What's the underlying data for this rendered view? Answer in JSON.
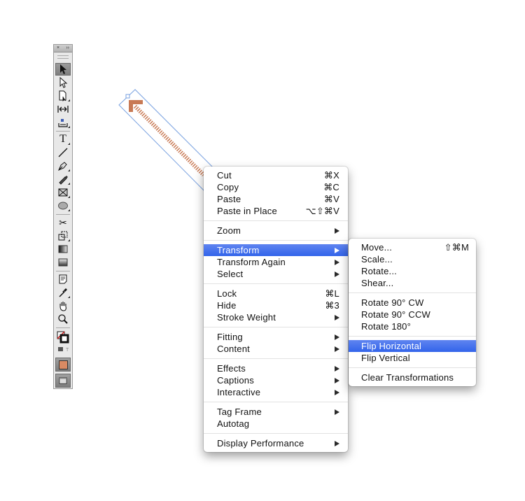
{
  "toolbox": {
    "close_glyph": "×",
    "collapse_glyph": "››",
    "tools": [
      {
        "name": "selection-tool",
        "active": true
      },
      {
        "name": "direct-selection-tool",
        "active": false
      },
      {
        "name": "page-tool",
        "active": false
      },
      {
        "name": "gap-tool",
        "active": false
      },
      {
        "name": "content-collector-tool",
        "active": false
      },
      {
        "name": "type-tool",
        "active": false,
        "glyph": "T"
      },
      {
        "name": "line-tool",
        "active": false
      },
      {
        "name": "pen-tool",
        "active": false
      },
      {
        "name": "pencil-tool",
        "active": false
      },
      {
        "name": "rectangle-frame-tool",
        "active": false
      },
      {
        "name": "ellipse-tool",
        "active": false
      },
      {
        "name": "scissors-tool",
        "active": false,
        "glyph": "✂"
      },
      {
        "name": "free-transform-tool",
        "active": false
      },
      {
        "name": "gradient-swatch-tool",
        "active": false
      },
      {
        "name": "gradient-feather-tool",
        "active": false
      },
      {
        "name": "note-tool",
        "active": false
      },
      {
        "name": "eyedropper-tool",
        "active": false
      },
      {
        "name": "hand-tool",
        "active": false
      },
      {
        "name": "zoom-tool",
        "active": false
      }
    ],
    "fill_color": "#ffffff",
    "stroke_color": "#c87a55",
    "formatting_swatch_color": "#d98a63"
  },
  "canvas": {
    "arrow_color": "#c87a55",
    "selection_color": "#7aa2e0"
  },
  "context_menu": {
    "groups": [
      [
        {
          "label": "Cut",
          "shortcut": "⌘X"
        },
        {
          "label": "Copy",
          "shortcut": "⌘C"
        },
        {
          "label": "Paste",
          "shortcut": "⌘V"
        },
        {
          "label": "Paste in Place",
          "shortcut": "⌥⇧⌘V"
        }
      ],
      [
        {
          "label": "Zoom",
          "submenu": true
        }
      ],
      [
        {
          "label": "Transform",
          "submenu": true,
          "highlighted": true
        },
        {
          "label": "Transform Again",
          "submenu": true
        },
        {
          "label": "Select",
          "submenu": true
        }
      ],
      [
        {
          "label": "Lock",
          "shortcut": "⌘L"
        },
        {
          "label": "Hide",
          "shortcut": "⌘3"
        },
        {
          "label": "Stroke Weight",
          "submenu": true
        }
      ],
      [
        {
          "label": "Fitting",
          "submenu": true
        },
        {
          "label": "Content",
          "submenu": true
        }
      ],
      [
        {
          "label": "Effects",
          "submenu": true
        },
        {
          "label": "Captions",
          "submenu": true
        },
        {
          "label": "Interactive",
          "submenu": true
        }
      ],
      [
        {
          "label": "Tag Frame",
          "submenu": true
        },
        {
          "label": "Autotag"
        }
      ],
      [
        {
          "label": "Display Performance",
          "submenu": true
        }
      ]
    ]
  },
  "transform_submenu": {
    "groups": [
      [
        {
          "label": "Move...",
          "shortcut": "⇧⌘M"
        },
        {
          "label": "Scale..."
        },
        {
          "label": "Rotate..."
        },
        {
          "label": "Shear..."
        }
      ],
      [
        {
          "label": "Rotate 90° CW"
        },
        {
          "label": "Rotate 90° CCW"
        },
        {
          "label": "Rotate 180°"
        }
      ],
      [
        {
          "label": "Flip Horizontal",
          "highlighted": true
        },
        {
          "label": "Flip Vertical"
        }
      ],
      [
        {
          "label": "Clear Transformations"
        }
      ]
    ]
  },
  "colors": {
    "highlight": "#3a6bec",
    "menu_text": "#111111"
  }
}
